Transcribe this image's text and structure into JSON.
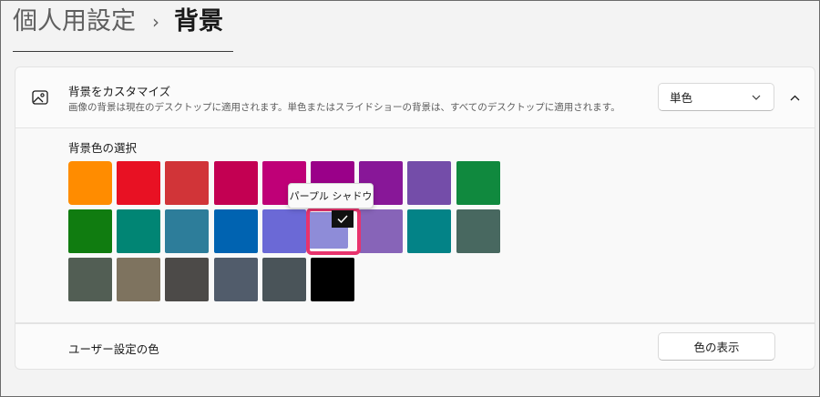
{
  "breadcrumb": {
    "parent": "個人用設定",
    "separator": "›",
    "current": "背景"
  },
  "setting": {
    "icon": "picture-icon",
    "title": "背景をカスタマイズ",
    "description": "画像の背景は現在のデスクトップに適用されます。単色またはスライドショーの背景は、すべてのデスクトップに適用されます。",
    "dropdown_value": "単色"
  },
  "color_section": {
    "label": "背景色の選択",
    "tooltip": "パープル シャドウ",
    "rows": [
      [
        "#ff8c00",
        "#e81123",
        "#d13438",
        "#c30052",
        "#bf0077",
        "#9a0089",
        "#881798",
        "#744da9",
        "#10893e"
      ],
      [
        "#107c10",
        "#018574",
        "#2d7d9a",
        "#0063b1",
        "#6b69d6",
        "#8e8cd8",
        "#8764b8",
        "#038387",
        "#486860"
      ],
      [
        "#525e54",
        "#7e735f",
        "#4c4a48",
        "#515c6b",
        "#4a5459",
        "#000000"
      ]
    ],
    "selected_color": "#8e8cd8"
  },
  "custom_color": {
    "label": "ユーザー設定の色",
    "button_label": "色の表示"
  },
  "colors": {
    "accent_ring": "#e8336d",
    "page_bg": "#f3f3f3"
  }
}
